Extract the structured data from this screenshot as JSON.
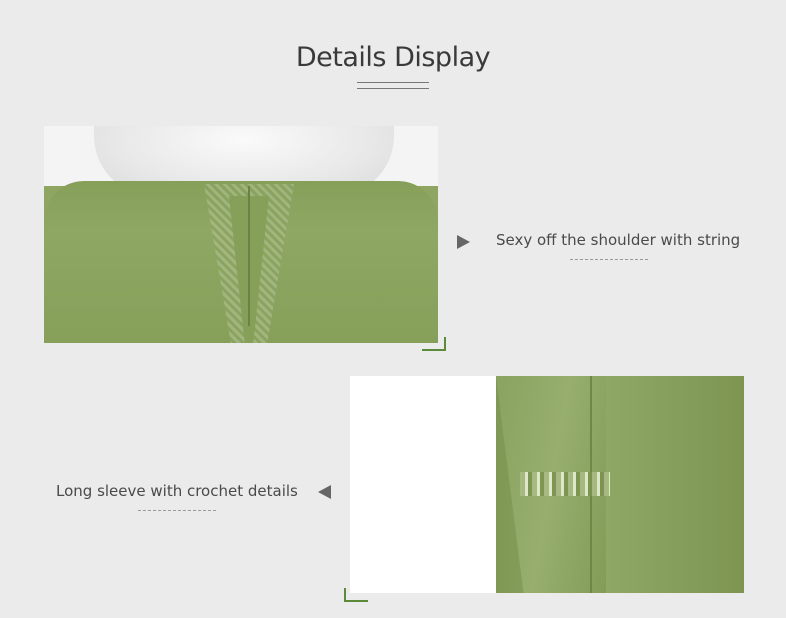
{
  "header": {
    "title": "Details Display"
  },
  "details": [
    {
      "caption": "Sexy off the shoulder with string",
      "image_alt": "off-shoulder top with lace-up string"
    },
    {
      "caption": "Long sleeve with crochet details",
      "image_alt": "long sleeve with crochet band"
    }
  ],
  "colors": {
    "background": "#ebebeb",
    "garment": "#8fa662",
    "accent": "#5a8a3a"
  }
}
